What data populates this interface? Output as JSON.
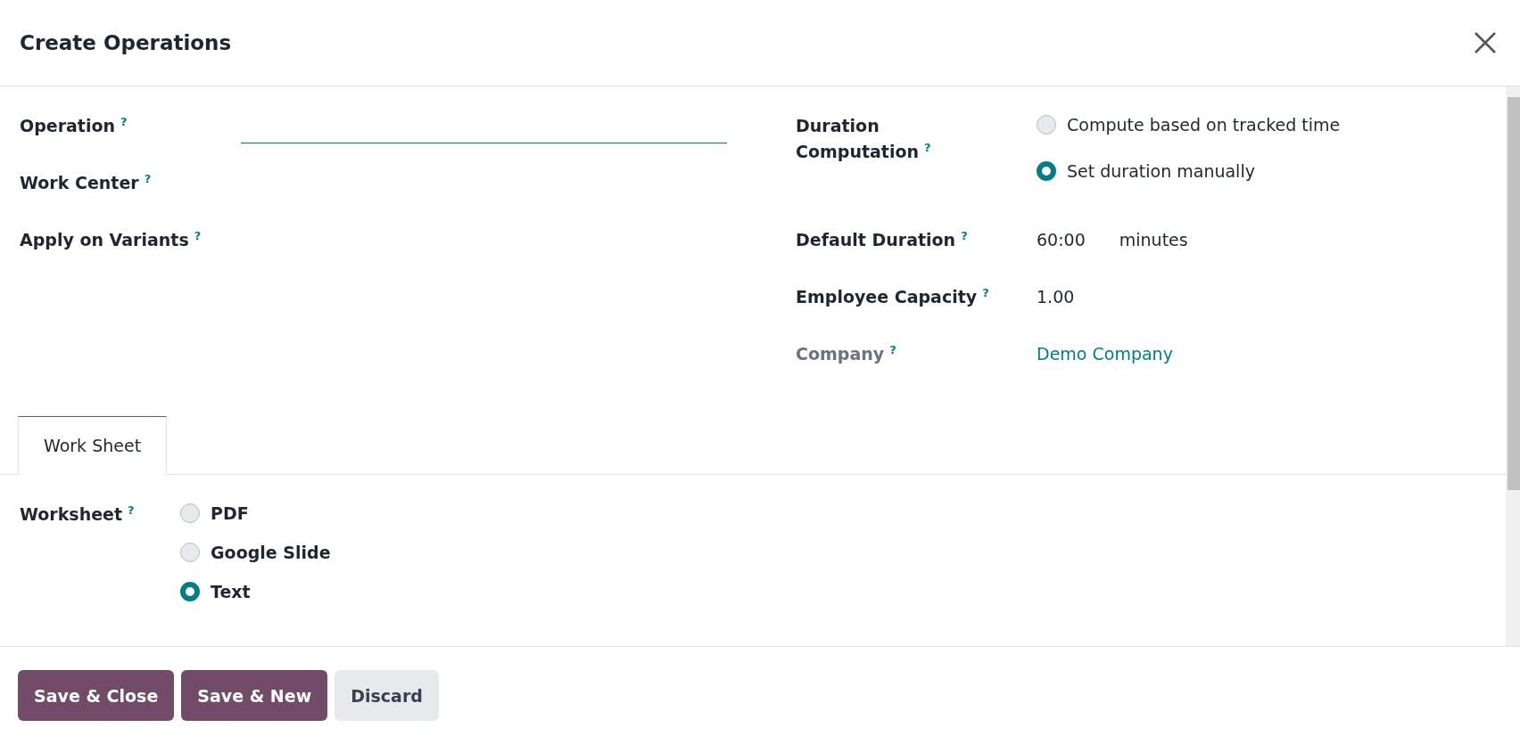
{
  "dialog": {
    "title": "Create Operations"
  },
  "left_fields": [
    {
      "label": "Operation",
      "help": "?",
      "kind": "input"
    },
    {
      "label": "Work Center",
      "help": "?",
      "kind": "empty"
    },
    {
      "label": "Apply on Variants",
      "help": "?",
      "kind": "empty"
    }
  ],
  "duration_computation": {
    "label": "Duration Computation",
    "help": "?",
    "options": [
      {
        "label": "Compute based on tracked time",
        "selected": false
      },
      {
        "label": "Set duration manually",
        "selected": true
      }
    ]
  },
  "right_fields": [
    {
      "label": "Default Duration",
      "help": "?",
      "value": "60:00",
      "unit": "minutes",
      "kind": "text",
      "disabled": false
    },
    {
      "label": "Employee Capacity",
      "help": "?",
      "value": "1.00",
      "kind": "text",
      "disabled": false
    },
    {
      "label": "Company",
      "help": "?",
      "value": "Demo Company",
      "kind": "link",
      "disabled": true
    }
  ],
  "tabs": [
    {
      "label": "Work Sheet",
      "selected": true
    }
  ],
  "worksheet": {
    "label": "Worksheet",
    "help": "?",
    "options": [
      {
        "label": "PDF",
        "selected": false
      },
      {
        "label": "Google Slide",
        "selected": false
      },
      {
        "label": "Text",
        "selected": true
      }
    ]
  },
  "buttons": [
    {
      "label": "Save & Close",
      "kind": "primary"
    },
    {
      "label": "Save & New",
      "kind": "primary"
    },
    {
      "label": "Discard",
      "kind": "secondary"
    }
  ]
}
